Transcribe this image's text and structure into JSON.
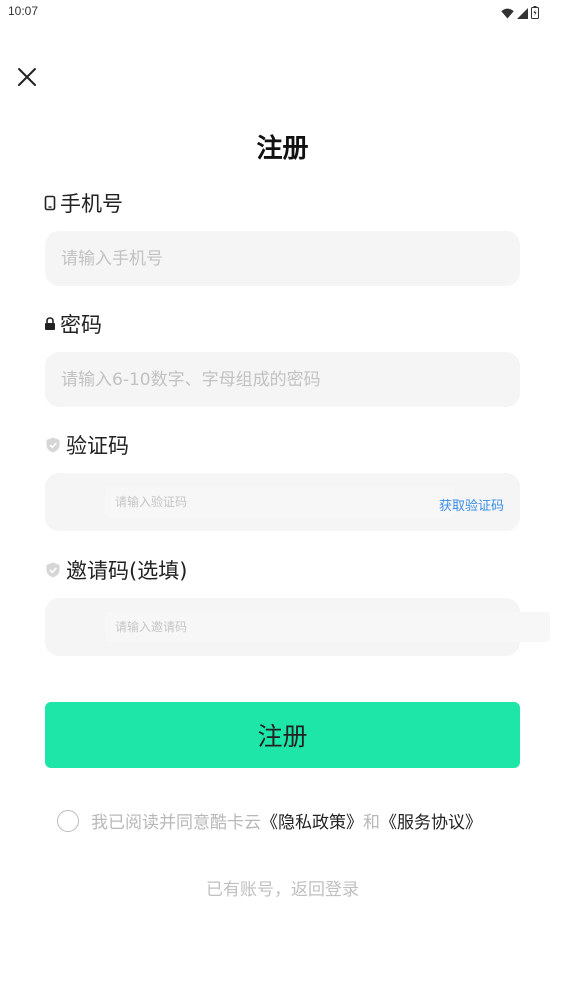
{
  "status_bar": {
    "time": "10:07",
    "icons": [
      "wifi-icon",
      "signal-icon",
      "battery-icon"
    ]
  },
  "header": {
    "close_icon": "close-icon",
    "title": "注册"
  },
  "form": {
    "phone": {
      "label": "手机号",
      "icon": "phone-icon",
      "placeholder": "请输入手机号"
    },
    "password": {
      "label": "密码",
      "icon": "lock-icon",
      "placeholder": "请输入6-10数字、字母组成的密码"
    },
    "verification": {
      "label": "验证码",
      "icon": "shield-icon",
      "placeholder": "请输入验证码",
      "get_code_label": "获取验证码"
    },
    "invite": {
      "label": "邀请码(选填)",
      "icon": "shield-icon",
      "placeholder": "请输入邀请码"
    }
  },
  "submit_label": "注册",
  "agreement": {
    "prefix": "我已阅读并同意酷卡云",
    "privacy_link": "《隐私政策》",
    "conjunction": "和",
    "service_link": "《服务协议》"
  },
  "back_to_login": "已有账号，返回登录",
  "colors": {
    "accent": "#1de6a8",
    "link": "#3a8ee6",
    "input_bg": "#f5f5f5"
  }
}
